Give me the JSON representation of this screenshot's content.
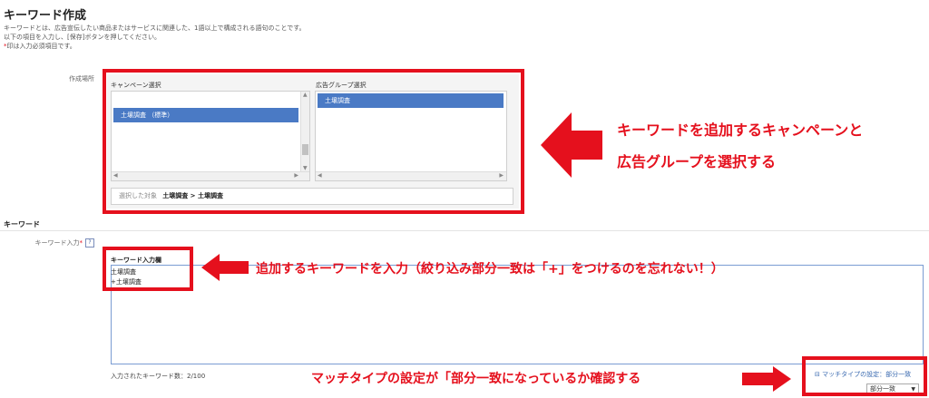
{
  "page": {
    "title": "キーワード作成",
    "description_1": "キーワードとは、広告宣伝したい商品またはサービスに関連した、1語以上で構成される語句のことです。",
    "description_2": "以下の項目を入力し、[保存]ボタンを押してください。",
    "required_note": "*印は入力必須項目です。",
    "required_mark": "*"
  },
  "location": {
    "label": "作成場所",
    "campaign_header": "キャンペーン選択",
    "adgroup_header": "広告グループ選択",
    "campaigns": [
      "土壌調査 （標準）"
    ],
    "adgroups": [
      "土壌調査"
    ],
    "selected_prefix": "選択した対象",
    "selected_value": "土壌調査 > 土壌調査"
  },
  "keyword_section": {
    "heading": "キーワード",
    "input_label": "キーワード入力",
    "help_icon": "?",
    "field_title": "キーワード入力欄",
    "keywords": [
      "土壌調査",
      "+土壌調査"
    ],
    "count_text": "入力されたキーワード数：2/100",
    "match_toggle_icon": "⊟",
    "match_type_link": "マッチタイプの設定：部分一致",
    "match_select_value": "部分一致"
  },
  "annotations": {
    "a1_line1": "キーワードを追加するキャンペーンと",
    "a1_line2": "広告グループを選択する",
    "a2": "追加するキーワードを入力（絞り込み部分一致は「+」をつけるのを忘れない！）",
    "a3": "マッチタイプの設定が「部分一致になっているか確認する"
  },
  "colors": {
    "annotation_red": "#e5101d",
    "selection_blue": "#4a7ac5"
  }
}
